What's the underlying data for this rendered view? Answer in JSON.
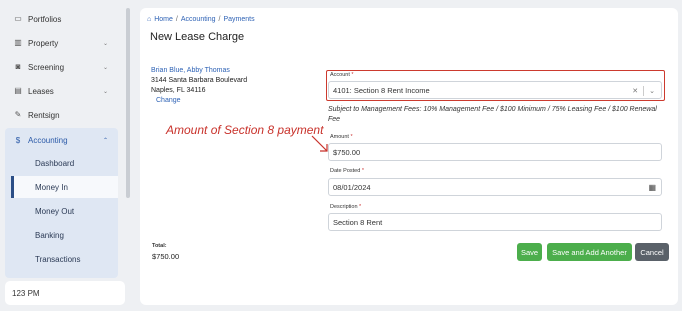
{
  "sidebar": {
    "items": [
      {
        "label": "Portfolios",
        "icon": "folder-icon",
        "glyph": "▭"
      },
      {
        "label": "Property",
        "icon": "building-icon",
        "glyph": "▥"
      },
      {
        "label": "Screening",
        "icon": "screening-icon",
        "glyph": "◙"
      },
      {
        "label": "Leases",
        "icon": "document-icon",
        "glyph": "▤"
      },
      {
        "label": "Rentsign",
        "icon": "pen-icon",
        "glyph": "✎"
      }
    ],
    "accounting": {
      "label": "Accounting",
      "icon": "dollar-icon",
      "glyph": "$",
      "subitems": [
        "Dashboard",
        "Money In",
        "Money Out",
        "Banking",
        "Transactions"
      ],
      "active": "Money In"
    },
    "clock": "123 PM"
  },
  "breadcrumb": {
    "home": "Home",
    "accounting": "Accounting",
    "current": "Payments"
  },
  "page_title": "New Lease Charge",
  "tenant": {
    "names": "Brian Blue, Abby Thomas",
    "address1": "3144 Santa Barbara Boulevard",
    "address2": "Naples, FL 34116",
    "change": "Change"
  },
  "form": {
    "account": {
      "label": "Account",
      "value": "4101: Section 8 Rent Income"
    },
    "fee_note": "Subject to Management Fees: 10% Management Fee / $100 Minimum / 75% Leasing Fee / $100 Renewal Fee",
    "amount": {
      "label": "Amount",
      "value": "$750.00"
    },
    "date_posted": {
      "label": "Date Posted",
      "value": "08/01/2024"
    },
    "description": {
      "label": "Description",
      "value": "Section 8 Rent"
    }
  },
  "annotation": "Amount of Section 8 payment",
  "total": {
    "label": "Total:",
    "value": "$750.00"
  },
  "buttons": {
    "save": "Save",
    "save_add": "Save and Add Another",
    "cancel": "Cancel"
  },
  "colors": {
    "accent": "#2e62b5",
    "save": "#4cae4c",
    "cancel": "#5a6169",
    "highlight": "#cc3a2e"
  }
}
